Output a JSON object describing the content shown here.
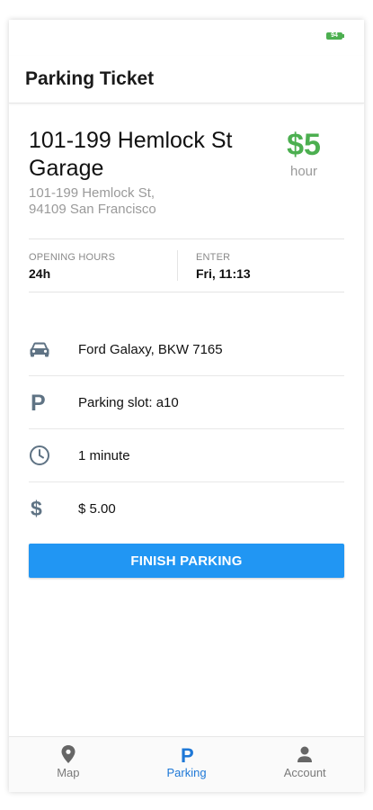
{
  "status_bar": {
    "battery": "94",
    "battery_color": "#4caf50"
  },
  "header": {
    "title": "Parking Ticket"
  },
  "location": {
    "name": "101-199 Hemlock St Garage",
    "address_line1": "101-199 Hemlock St,",
    "address_line2": "94109 San Francisco",
    "price": "$5",
    "price_unit": "hour",
    "price_color": "#4caf50"
  },
  "info": {
    "opening_hours_label": "OPENING HOURS",
    "opening_hours_value": "24h",
    "enter_label": "ENTER",
    "enter_value": "Fri, 11:13"
  },
  "details": {
    "car": {
      "icon": "car-icon",
      "text": "Ford Galaxy, BKW 7165"
    },
    "slot": {
      "icon": "parking-icon",
      "text": "Parking slot: a10"
    },
    "duration": {
      "icon": "clock-icon",
      "text": "1 minute"
    },
    "cost": {
      "icon": "dollar-icon",
      "text": "$ 5.00"
    }
  },
  "actions": {
    "finish_label": "FINISH PARKING",
    "accent_color": "#2196f3"
  },
  "nav": {
    "items": [
      {
        "label": "Map",
        "icon": "map-pin-icon"
      },
      {
        "label": "Parking",
        "icon": "parking-icon",
        "active": true
      },
      {
        "label": "Account",
        "icon": "person-icon"
      }
    ]
  }
}
